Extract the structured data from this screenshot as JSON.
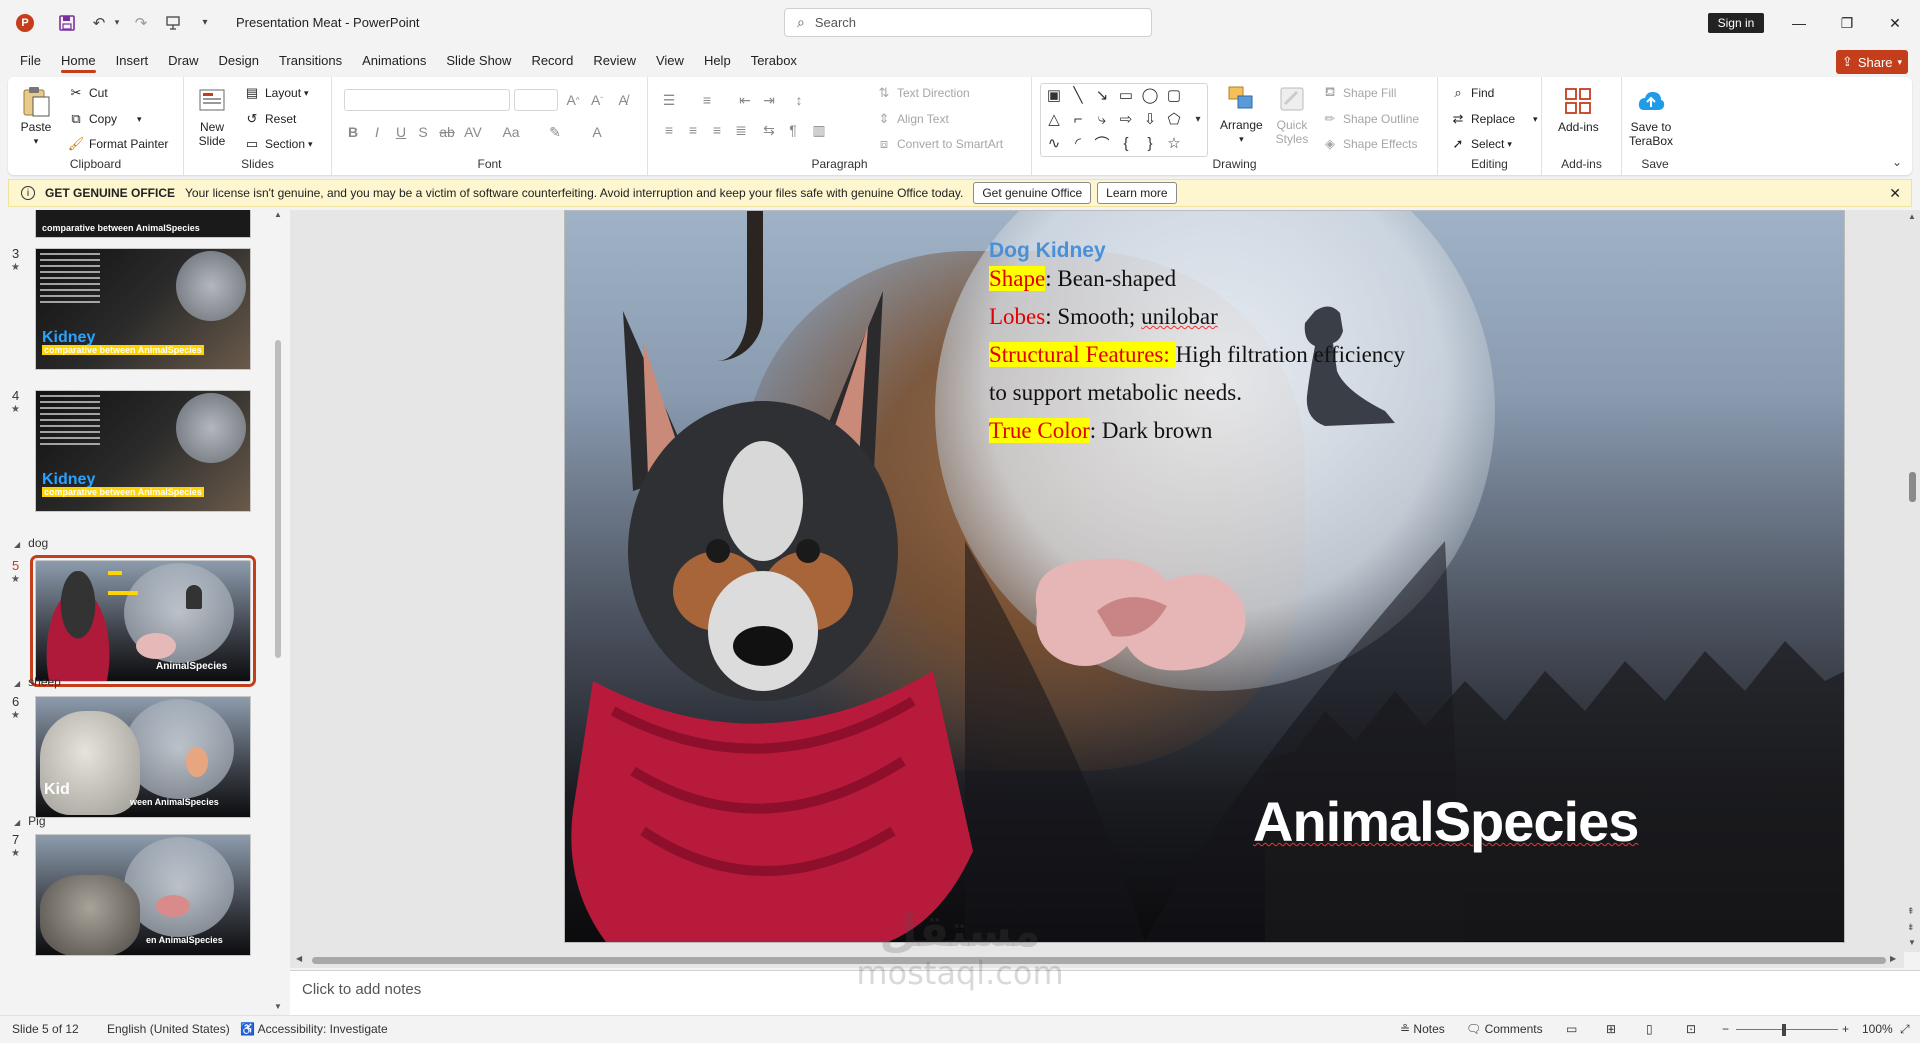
{
  "app": {
    "doc_title": "Presentation Meat  -  PowerPoint",
    "search_placeholder": "Search",
    "sign_in": "Sign in",
    "share": "Share"
  },
  "tabs": [
    "File",
    "Home",
    "Insert",
    "Draw",
    "Design",
    "Transitions",
    "Animations",
    "Slide Show",
    "Record",
    "Review",
    "View",
    "Help",
    "Terabox"
  ],
  "ribbon": {
    "clipboard": {
      "label": "Clipboard",
      "paste": "Paste",
      "cut": "Cut",
      "copy": "Copy",
      "format_painter": "Format Painter"
    },
    "slides": {
      "label": "Slides",
      "new_slide": "New Slide",
      "layout": "Layout",
      "reset": "Reset",
      "section": "Section"
    },
    "font": {
      "label": "Font"
    },
    "paragraph": {
      "label": "Paragraph",
      "text_direction": "Text Direction",
      "align_text": "Align Text",
      "convert_smartart": "Convert to SmartArt"
    },
    "drawing": {
      "label": "Drawing",
      "arrange": "Arrange",
      "quick_styles": "Quick Styles",
      "shape_fill": "Shape Fill",
      "shape_outline": "Shape Outline",
      "shape_effects": "Shape Effects"
    },
    "editing": {
      "label": "Editing",
      "find": "Find",
      "replace": "Replace",
      "select": "Select"
    },
    "addins": {
      "label": "Add-ins",
      "addins_btn": "Add-ins"
    },
    "save": {
      "label": "Save",
      "save_terabox": "Save to TeraBox"
    }
  },
  "notification": {
    "title": "GET GENUINE OFFICE",
    "message": "Your license isn't genuine, and you may be a victim of software counterfeiting. Avoid interruption and keep your files safe with genuine Office today.",
    "btn_genuine": "Get genuine Office",
    "btn_learn": "Learn more"
  },
  "slide_panel": {
    "items": [
      {
        "num": "3",
        "star": "★"
      },
      {
        "num": "4",
        "star": "★"
      },
      {
        "section": "dog"
      },
      {
        "num": "5",
        "star": "★"
      },
      {
        "section": "sheep"
      },
      {
        "num": "6",
        "star": "★"
      },
      {
        "section": "Pig"
      },
      {
        "num": "7",
        "star": "★"
      }
    ],
    "thumb_text": {
      "kidney": "Kidney",
      "comparative": "comparative  between AnimalSpecies",
      "species": "AnimalSpecies",
      "sheep_kid": "Kid",
      "sheep_tail": "ween AnimalSpecies",
      "pig_tail": "en AnimalSpecies",
      "top_tail": "comparative  between AnimalSpecies"
    }
  },
  "slide": {
    "heading": "Dog Kidney",
    "shape_label": "Shape",
    "shape_value": ": Bean-shaped",
    "lobes_label": "Lobes",
    "lobes_value_a": ": Smooth; ",
    "lobes_value_b": "unilobar",
    "structural_label": "Structural Features: ",
    "structural_value": "High filtration efficiency",
    "structural_cont": " to support metabolic needs.",
    "color_label": "True Color",
    "color_value": ": Dark brown",
    "species": "AnimalSpecies"
  },
  "notes_placeholder": "Click to add notes",
  "watermark": {
    "arabic": "مستقل",
    "latin": "mostaql.com"
  },
  "status": {
    "slide_of": "Slide 5 of 12",
    "language": "English (United States)",
    "accessibility": "Accessibility: Investigate",
    "notes": "Notes",
    "comments": "Comments",
    "zoom": "100%"
  },
  "colors": {
    "accent": "#c43e1c",
    "heading_blue": "#4a90d9",
    "highlight_yellow": "#ffff00",
    "lobes_red": "#e00000"
  }
}
